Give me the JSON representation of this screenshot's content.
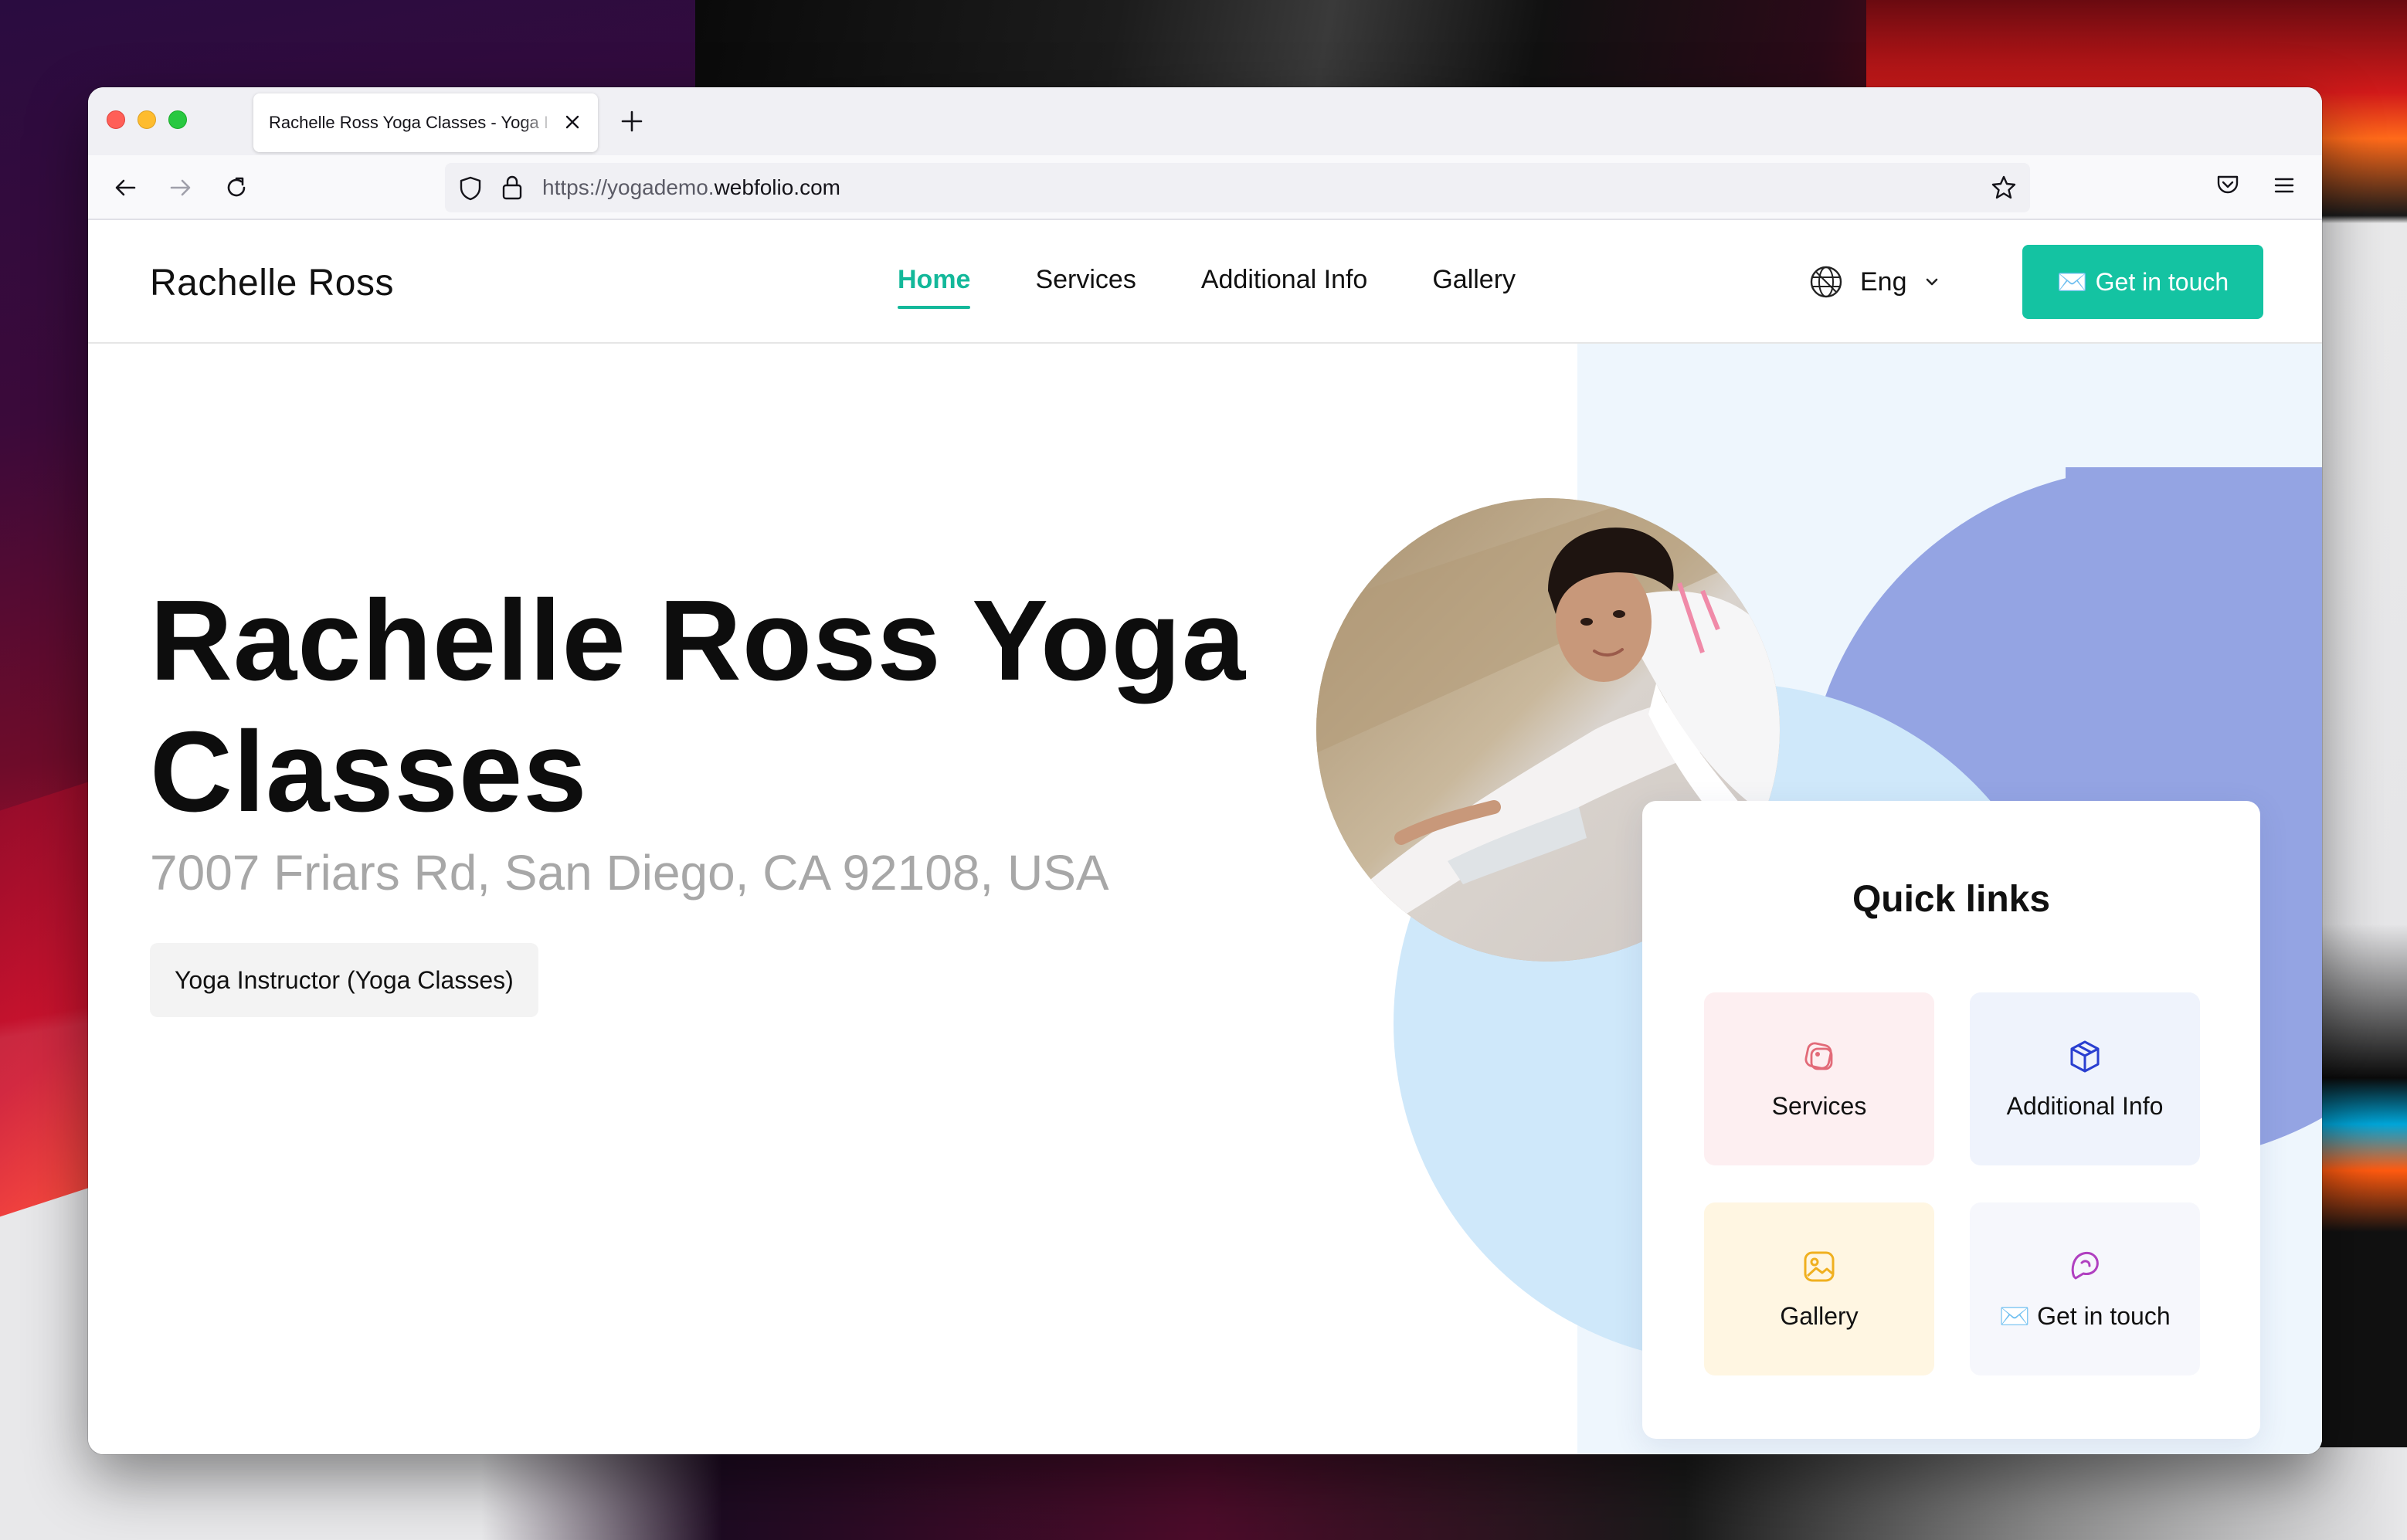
{
  "browser": {
    "tab_title": "Rachelle Ross Yoga Classes - Yoga I",
    "url_prefix": "https://yogademo.",
    "url_domain": "webfolio.com"
  },
  "site": {
    "brand": "Rachelle Ross",
    "nav": [
      {
        "label": "Home",
        "active": true
      },
      {
        "label": "Services"
      },
      {
        "label": "Additional Info"
      },
      {
        "label": "Gallery"
      }
    ],
    "language": "Eng",
    "cta_label": "Get in touch",
    "cta_emoji": "✉️"
  },
  "hero": {
    "title": "Rachelle Ross Yoga Classes",
    "address": "7007 Friars Rd, San Diego, CA 92108, USA",
    "chip": "Yoga Instructor (Yoga Classes)"
  },
  "quick_links": {
    "title": "Quick links",
    "items": [
      {
        "label": "Services",
        "icon": "services-icon",
        "color": "#e26a78"
      },
      {
        "label": "Additional Info",
        "icon": "cube-icon",
        "color": "#2a3fd0"
      },
      {
        "label": "Gallery",
        "icon": "image-icon",
        "color": "#f0b020"
      },
      {
        "label": "Get in touch",
        "emoji": "✉️",
        "icon": "chat-icon",
        "color": "#b040c0"
      }
    ]
  },
  "colors": {
    "accent": "#14c3a2",
    "right_panel": "#eef6fd",
    "blob_purple": "#94a4e3",
    "blob_blue": "#cfe8fa"
  }
}
